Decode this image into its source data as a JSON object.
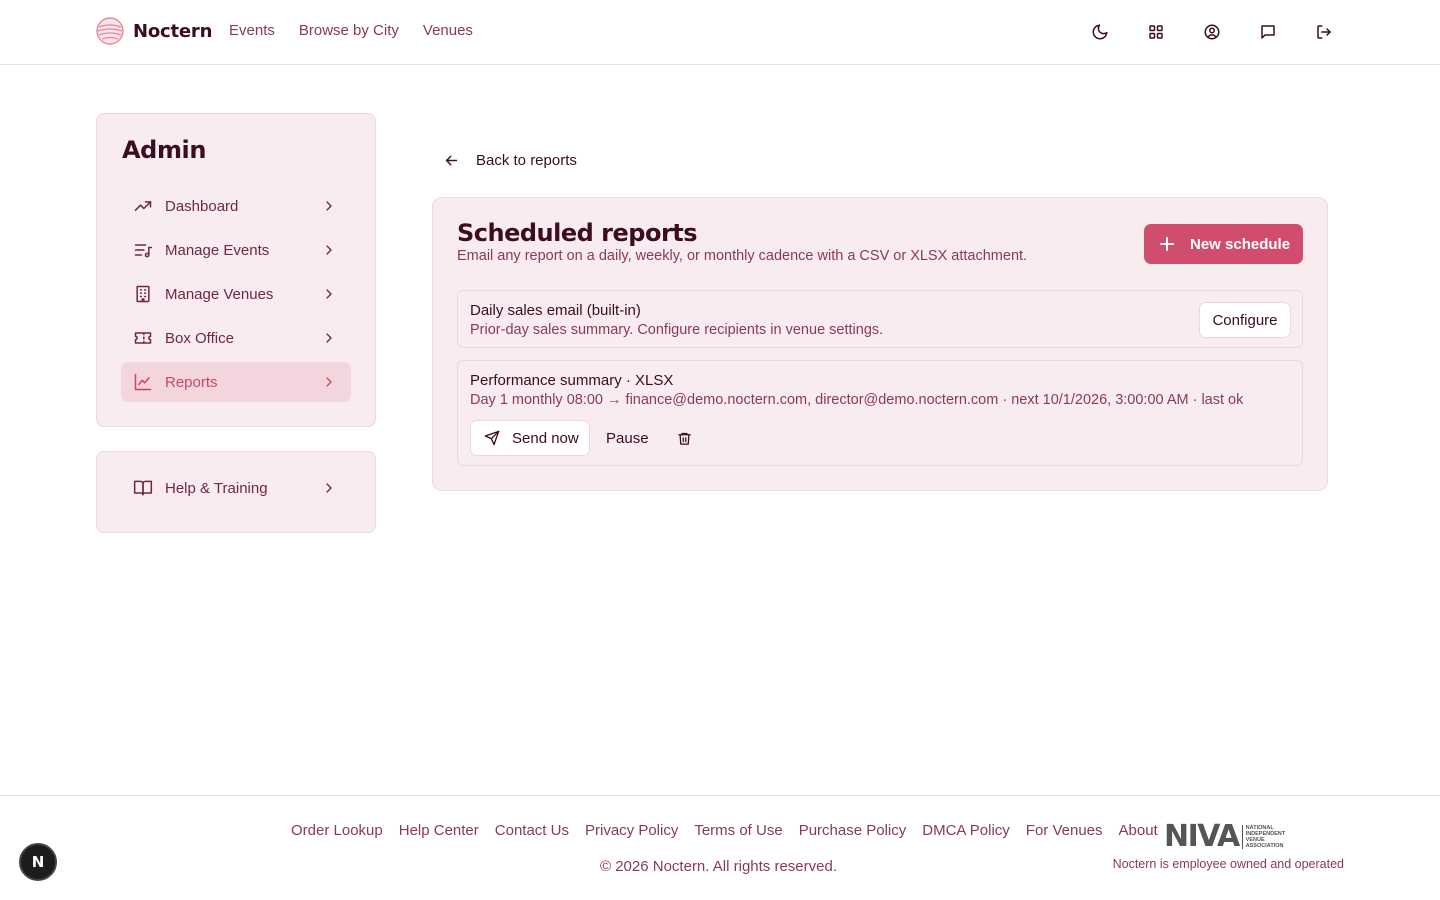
{
  "header": {
    "brand": "Noctern",
    "nav": [
      "Events",
      "Browse by City",
      "Venues"
    ],
    "icons": [
      "moon-icon",
      "grid-icon",
      "user-circle-icon",
      "message-icon",
      "logout-icon"
    ]
  },
  "sidebar": {
    "title": "Admin",
    "items": [
      {
        "label": "Dashboard",
        "icon": "trending-icon",
        "active": false
      },
      {
        "label": "Manage Events",
        "icon": "music-list-icon",
        "active": false
      },
      {
        "label": "Manage Venues",
        "icon": "building-icon",
        "active": false
      },
      {
        "label": "Box Office",
        "icon": "ticket-icon",
        "active": false
      },
      {
        "label": "Reports",
        "icon": "chart-icon",
        "active": true
      }
    ],
    "help": {
      "label": "Help & Training",
      "icon": "book-icon"
    }
  },
  "main": {
    "back_label": "Back to reports",
    "title": "Scheduled reports",
    "subtitle": "Email any report on a daily, weekly, or monthly cadence with a CSV or XLSX attachment.",
    "new_button": "New schedule",
    "schedules": [
      {
        "title": "Daily sales email (built-in)",
        "description": "Prior-day sales summary. Configure recipients in venue settings.",
        "action": "Configure"
      },
      {
        "title": "Performance summary · XLSX",
        "description": "Day 1 monthly 08:00 → finance@demo.noctern.com, director@demo.noctern.com · next 10/1/2026, 3:00:00 AM · last ok",
        "send_now": "Send now",
        "pause": "Pause"
      }
    ]
  },
  "footer": {
    "links": [
      "Order Lookup",
      "Help Center",
      "Contact Us",
      "Privacy Policy",
      "Terms of Use",
      "Purchase Policy",
      "DMCA Policy",
      "For Venues",
      "About"
    ],
    "copyright": "© 2026 Noctern. All rights reserved.",
    "niva_logo": "NIVA",
    "niva_text": "NATIONAL INDEPENDENT VENUE ASSOCIATION",
    "employee_note": "Noctern is employee owned and operated"
  },
  "dev_badge": "N",
  "colors": {
    "accent": "#d14d6e",
    "text": "#3b0d1e",
    "muted": "#8a3a56",
    "card_bg": "#f9ecef",
    "active_bg": "#f3d5de"
  }
}
